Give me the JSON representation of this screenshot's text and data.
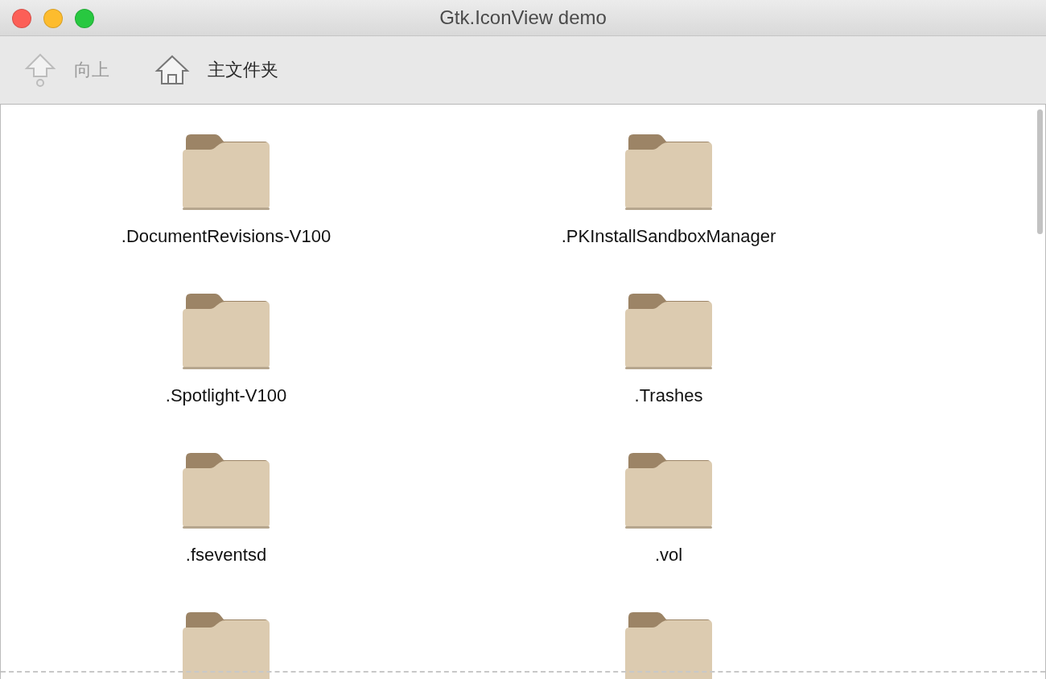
{
  "window": {
    "title": "Gtk.IconView demo"
  },
  "toolbar": [
    {
      "kind": "up",
      "label": "向上",
      "disabled": true
    },
    {
      "kind": "home",
      "label": "主文件夹",
      "disabled": false
    }
  ],
  "items": [
    {
      "kind": "folder",
      "label": ".DocumentRevisions-V100"
    },
    {
      "kind": "folder",
      "label": ".PKInstallSandboxManager"
    },
    {
      "kind": "folder",
      "label": ".Spotlight-V100"
    },
    {
      "kind": "folder",
      "label": ".Trashes"
    },
    {
      "kind": "folder",
      "label": ".fseventsd"
    },
    {
      "kind": "folder",
      "label": ".vol"
    },
    {
      "kind": "folder"
    },
    {
      "kind": "folder"
    }
  ]
}
